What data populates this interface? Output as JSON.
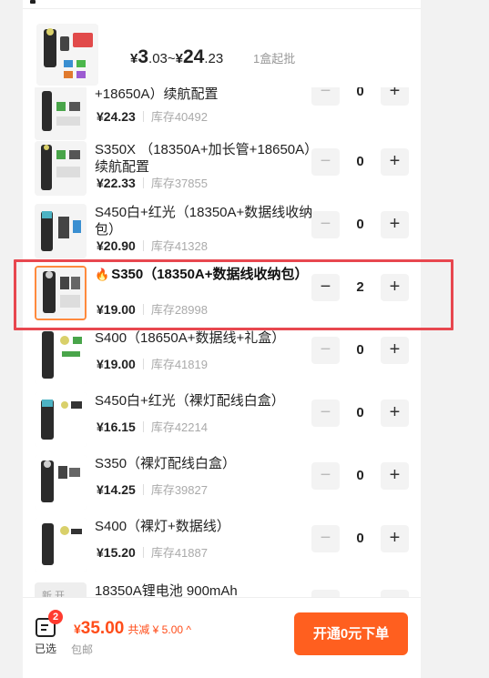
{
  "header": {
    "price": {
      "yen1": "¥",
      "big1": "3",
      "small1": ".03",
      "sep": "~",
      "yen2": "¥",
      "big2": "24",
      "small2": ".23"
    },
    "min_order": "1盒起批"
  },
  "items": [
    {
      "title": "+18650A）续航配置",
      "price": "¥24.23",
      "stock": "库存40492",
      "qty": "0",
      "fire": false
    },
    {
      "title": "S350X （18350A+加长管+18650A）续航配置",
      "price": "¥22.33",
      "stock": "库存37855",
      "qty": "0",
      "fire": false
    },
    {
      "title": "S450白+红光（18350A+数据线收纳包）",
      "price": "¥20.90",
      "stock": "库存41328",
      "qty": "0",
      "fire": false
    },
    {
      "title": "S350（18350A+数据线收纳包）",
      "price": "¥19.00",
      "stock": "库存28998",
      "qty": "2",
      "fire": true
    },
    {
      "title": "S400（18650A+数据线+礼盒）",
      "price": "¥19.00",
      "stock": "库存41819",
      "qty": "0",
      "fire": false
    },
    {
      "title": "S450白+红光（裸灯配线白盒）",
      "price": "¥16.15",
      "stock": "库存42214",
      "qty": "0",
      "fire": false
    },
    {
      "title": "S350（裸灯配线白盒）",
      "price": "¥14.25",
      "stock": "库存39827",
      "qty": "0",
      "fire": false
    },
    {
      "title": "S400（裸灯+数据线）",
      "price": "¥15.20",
      "stock": "库存41887",
      "qty": "0",
      "fire": false
    },
    {
      "title": "18350A锂电池 900mAh",
      "price": "",
      "stock": "",
      "qty": "0",
      "fire": false,
      "thumb_text": "新 开"
    }
  ],
  "stepper": {
    "minus": "−",
    "plus": "+"
  },
  "footer": {
    "badge": "2",
    "selected_label": "已选",
    "total_yen": "¥",
    "total_amount": "35.00",
    "discount": "共减 ¥ 5.00 ^",
    "shipping": "包邮",
    "order_button": "开通0元下单"
  },
  "colors": {
    "accent": "#ff5f1f",
    "price_red": "#ff4d1a",
    "highlight_border": "#e8474f"
  }
}
